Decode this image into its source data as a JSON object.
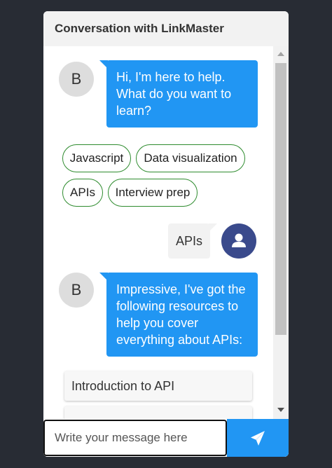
{
  "header": {
    "title": "Conversation with LinkMaster"
  },
  "bot": {
    "avatar_letter": "B"
  },
  "messages": {
    "greeting": [
      "Hi, I'm here to help.",
      "What do you want to",
      "learn?"
    ],
    "options": [
      "Javascript",
      "Data visualization",
      "APIs",
      "Interview prep"
    ],
    "user_reply": "APIs",
    "response": [
      "Impressive, I've got the",
      "following resources to",
      "help you cover",
      "everything about APIs:"
    ],
    "resources": [
      "Introduction to API",
      ""
    ]
  },
  "composer": {
    "placeholder": "Write your message here"
  },
  "icons": {
    "user_avatar": "person-icon",
    "send": "paper-plane-icon",
    "scroll_up": "triangle-up-icon",
    "scroll_down": "triangle-down-icon"
  },
  "colors": {
    "accent": "#2196f3",
    "option_border": "#2e8b2e",
    "user_avatar": "#3a4a8c",
    "background": "#282c34"
  }
}
